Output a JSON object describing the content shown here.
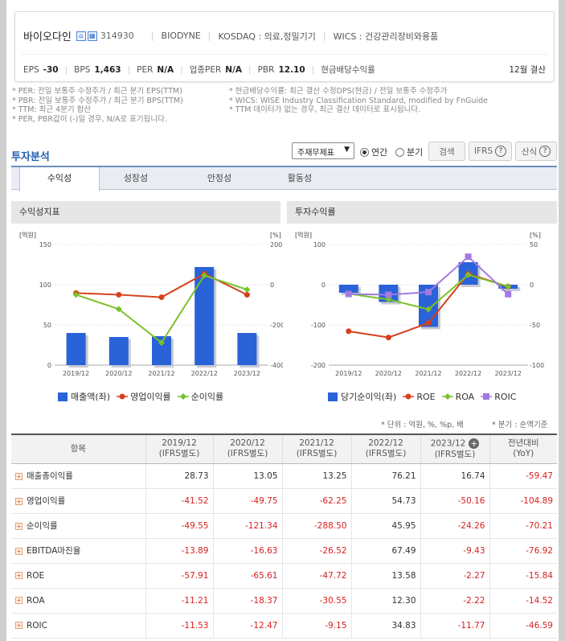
{
  "company": {
    "name": "바이오다인",
    "code": "314930",
    "eng_name": "BIODYNE",
    "market": "KOSDAQ : 의료,정밀기기",
    "wics": "WICS : 건강관리장비와용품",
    "settlement": "12월 결산"
  },
  "metrics": [
    {
      "label": "EPS",
      "value": "-30"
    },
    {
      "label": "BPS",
      "value": "1,463"
    },
    {
      "label": "PER",
      "value": "N/A"
    },
    {
      "label": "업종PER",
      "value": "N/A"
    },
    {
      "label": "PBR",
      "value": "12.10"
    },
    {
      "label": "현금배당수익률",
      "value": ""
    }
  ],
  "notes_left": [
    "* PER: 전일 보통주 수정주가 / 최근 분기 EPS(TTM)",
    "* PBR: 전일 보통주 수정주가 / 최근 분기 BPS(TTM)",
    "* TTM: 최근 4분기 합산",
    "* PER, PBR값이 (-)일 경우, N/A로 표기됩니다."
  ],
  "notes_right": [
    "* 현금배당수익률: 최근 결산 수정DPS(현금) / 전일 보통주 수정주가",
    "* WICS: WISE Industry Classification Standard, modified by FnGuide",
    "* TTM 데이터가 없는 경우, 최근 결산 데이터로 표시됩니다."
  ],
  "section_title": "투자분석",
  "controls": {
    "select_value": "주재무제표",
    "radio_annual": "연간",
    "radio_quarter": "분기",
    "search": "검색",
    "ifrs": "IFRS",
    "calc": "산식"
  },
  "tabs": [
    "수익성",
    "성장성",
    "안정성",
    "활동성"
  ],
  "panels": {
    "left_title": "수익성지표",
    "right_title": "투자수익률"
  },
  "chart_data": [
    {
      "type": "bar",
      "title": "수익성지표",
      "categories": [
        "2019/12",
        "2020/12",
        "2021/12",
        "2022/12",
        "2023/12"
      ],
      "left_axis": {
        "unit": "[억원]",
        "ylim": [
          0,
          150
        ],
        "ticks": [
          "150",
          "100",
          "50",
          "0"
        ]
      },
      "right_axis": {
        "unit": "[%]",
        "ylim": [
          -400,
          200
        ],
        "ticks": [
          "200",
          "0",
          "-200",
          "-400"
        ]
      },
      "series": [
        {
          "name": "매출액(좌)",
          "kind": "bar",
          "axis": "left",
          "color": "#2a62d8",
          "values": [
            40,
            35,
            36,
            122,
            40
          ]
        },
        {
          "name": "영업이익률",
          "kind": "line",
          "axis": "right",
          "color": "#d6401c",
          "values": [
            -41.52,
            -49.75,
            -62.25,
            54.73,
            -50.16
          ]
        },
        {
          "name": "순이익률",
          "kind": "line",
          "axis": "right",
          "color": "#79c22a",
          "values": [
            -49.55,
            -121.34,
            -288.5,
            45.95,
            -24.26
          ]
        }
      ]
    },
    {
      "type": "bar",
      "title": "투자수익률",
      "categories": [
        "2019/12",
        "2020/12",
        "2021/12",
        "2022/12",
        "2023/12"
      ],
      "left_axis": {
        "unit": "[억원]",
        "ylim": [
          -200,
          100
        ],
        "ticks": [
          "100",
          "0",
          "-100",
          "-200"
        ]
      },
      "right_axis": {
        "unit": "[%]",
        "ylim": [
          -100,
          50
        ],
        "ticks": [
          "50",
          "0",
          "-50",
          "-100"
        ]
      },
      "series": [
        {
          "name": "당기순이익(좌)",
          "kind": "bar",
          "axis": "left",
          "color": "#2a62d8",
          "values": [
            -20,
            -43,
            -105,
            56,
            -10
          ]
        },
        {
          "name": "ROE",
          "kind": "line",
          "axis": "right",
          "color": "#d6401c",
          "values": [
            -57.91,
            -65.61,
            -47.72,
            13.58,
            -2.27
          ]
        },
        {
          "name": "ROA",
          "kind": "line",
          "axis": "right",
          "color": "#79c22a",
          "values": [
            -11.21,
            -18.37,
            -30.55,
            12.3,
            -2.22
          ]
        },
        {
          "name": "ROIC",
          "kind": "line",
          "axis": "right",
          "color": "#a27ae0",
          "values": [
            -11.53,
            -12.47,
            -9.15,
            34.83,
            -11.77
          ]
        }
      ]
    }
  ],
  "unit_note_left": "* 단위 : 억원, %, %p, 배",
  "unit_note_right": "* 분기 : 순액기준",
  "table": {
    "header_item": "항목",
    "columns": [
      {
        "year": "2019/12",
        "basis": "(IFRS별도)"
      },
      {
        "year": "2020/12",
        "basis": "(IFRS별도)"
      },
      {
        "year": "2021/12",
        "basis": "(IFRS별도)"
      },
      {
        "year": "2022/12",
        "basis": "(IFRS별도)"
      },
      {
        "year": "2023/12",
        "basis": "(IFRS별도)"
      }
    ],
    "yoy_header": {
      "line1": "전년대비",
      "line2": "(YoY)"
    },
    "rows": [
      {
        "label": "매출총이익률",
        "values": [
          "28.73",
          "13.05",
          "13.25",
          "76.21",
          "16.74"
        ],
        "yoy": "-59.47"
      },
      {
        "label": "영업이익률",
        "values": [
          "-41.52",
          "-49.75",
          "-62.25",
          "54.73",
          "-50.16"
        ],
        "yoy": "-104.89"
      },
      {
        "label": "순이익률",
        "values": [
          "-49.55",
          "-121.34",
          "-288.50",
          "45.95",
          "-24.26"
        ],
        "yoy": "-70.21"
      },
      {
        "label": "EBITDA마진율",
        "values": [
          "-13.89",
          "-16.63",
          "-26.52",
          "67.49",
          "-9.43"
        ],
        "yoy": "-76.92"
      },
      {
        "label": "ROE",
        "values": [
          "-57.91",
          "-65.61",
          "-47.72",
          "13.58",
          "-2.27"
        ],
        "yoy": "-15.84"
      },
      {
        "label": "ROA",
        "values": [
          "-11.21",
          "-18.37",
          "-30.55",
          "12.30",
          "-2.22"
        ],
        "yoy": "-14.52"
      },
      {
        "label": "ROIC",
        "values": [
          "-11.53",
          "-12.47",
          "-9.15",
          "34.83",
          "-11.77"
        ],
        "yoy": "-46.59"
      }
    ]
  }
}
